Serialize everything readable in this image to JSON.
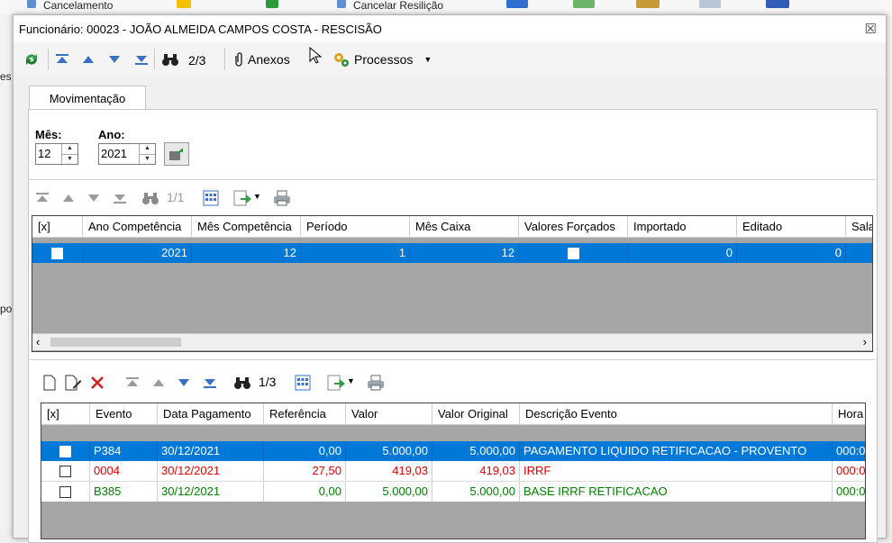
{
  "background": {
    "top_items": [
      "Cancelamento",
      "Cancelar Resilição"
    ],
    "left_cut": [
      "es",
      "po"
    ]
  },
  "window": {
    "title": "Funcionário: 00023 - JOÃO ALMEIDA CAMPOS COSTA - RESCISÃO",
    "close_glyph": "☒"
  },
  "toolbar": {
    "record_position": "2/3",
    "attachments_label": "Anexos",
    "processes_label": "Processos"
  },
  "tab": {
    "label": "Movimentação"
  },
  "filters": {
    "month_label": "Mês:",
    "month_value": "12",
    "year_label": "Ano:",
    "year_value": "2021"
  },
  "grid1": {
    "position": "1/1",
    "columns": [
      "[x]",
      "Ano Competência",
      "Mês Competência",
      "Período",
      "Mês Caixa",
      "Valores Forçados",
      "Importado",
      "Editado",
      "Sala"
    ],
    "rows": [
      {
        "ano": "2021",
        "mes": "12",
        "periodo": "1",
        "mes_caixa": "12",
        "importado": "0",
        "editado": "0"
      }
    ]
  },
  "grid2": {
    "position": "1/3",
    "columns": [
      "[x]",
      "Evento",
      "Data Pagamento",
      "Referência",
      "Valor",
      "Valor Original",
      "Descrição Evento",
      "Hora"
    ],
    "rows": [
      {
        "evento": "P384",
        "data": "30/12/2021",
        "ref": "0,00",
        "valor": "5.000,00",
        "original": "5.000,00",
        "descricao": "PAGAMENTO LIQUIDO RETIFICACAO - PROVENTO",
        "hora": "000:0"
      },
      {
        "evento": "0004",
        "data": "30/12/2021",
        "ref": "27,50",
        "valor": "419,03",
        "original": "419,03",
        "descricao": "IRRF",
        "hora": "000:0"
      },
      {
        "evento": "B385",
        "data": "30/12/2021",
        "ref": "0,00",
        "valor": "5.000,00",
        "original": "5.000,00",
        "descricao": "BASE IRRF RETIFICACAO",
        "hora": "000:0"
      }
    ]
  }
}
